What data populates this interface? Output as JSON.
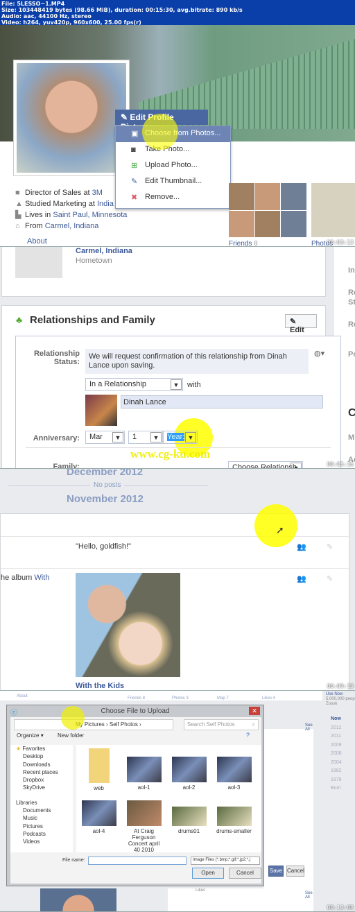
{
  "file_info": {
    "lines": [
      "File: 5LESSO~1.MP4",
      "Size: 103448419 bytes (98.66 MiB), duration: 00:15:30, avg.bitrate: 890 kb/s",
      "Audio: aac, 44100 Hz, stereo",
      "Video: h264, yuv420p, 960x600, 25.00 fps(r)"
    ]
  },
  "frame1": {
    "timestamp": "00:03:13",
    "menu_header": "Edit Profile Picture",
    "menu_items": [
      {
        "label": "Choose from Photos...",
        "icon": "photos-icon"
      },
      {
        "label": "Take Photo...",
        "icon": "camera-icon"
      },
      {
        "label": "Upload Photo...",
        "icon": "upload-photo-icon"
      },
      {
        "label": "Edit Thumbnail...",
        "icon": "pencil-icon"
      },
      {
        "label": "Remove...",
        "icon": "remove-icon"
      }
    ],
    "info": [
      {
        "pre": "Director of Sales at ",
        "link": "3M",
        "icon": "briefcase-icon"
      },
      {
        "pre": "Studied Marketing at ",
        "link": "India",
        "icon": "graduation-icon"
      },
      {
        "pre": "Lives in ",
        "link": "Saint Paul, Minnesota",
        "icon": "city-icon"
      },
      {
        "pre": "From ",
        "link": "Carmel, Indiana",
        "icon": "home-icon"
      }
    ],
    "about": "About",
    "friends": "Friends",
    "friends_count": "8",
    "photos": "Photos"
  },
  "frame2": {
    "timestamp": "00:05:16",
    "hometown": "Carmel, Indiana",
    "hometown_label": "Hometown",
    "section_title": "Relationships and Family",
    "edit": "Edit",
    "rel_label": "Relationship Status:",
    "notice": "We will request confirmation of this relationship from Dinah Lance upon saving.",
    "status": "In a Relationship",
    "with": "with",
    "partner": "Dinah Lance",
    "anniv_label": "Anniversary:",
    "month": "Mar",
    "day": "1",
    "year": "Year:",
    "family_label": "Family:",
    "choose_rel": "Choose Relationsh",
    "watermark": "www.cg-ku.com",
    "side": [
      "In",
      "Re",
      "St",
      "Re",
      "Po",
      "C",
      "M",
      "Ac"
    ]
  },
  "frame3": {
    "timestamp": "00:09:19",
    "month1": "December 2012",
    "no_posts": "No posts",
    "month2": "November 2012",
    "post1": "\"Hello, goldfish!\"",
    "album_pre": "he album ",
    "album_link": "With",
    "album_title": "With the Kids"
  },
  "frame4": {
    "timestamp": "00:13:08",
    "tabs": [
      "About",
      "Friends 8",
      "Photos 3",
      "Map 7",
      "Likes 4"
    ],
    "dialog_title": "Choose File to Upload",
    "path": [
      "My Pictures",
      "Self Photos"
    ],
    "search_placeholder": "Search Self Photos",
    "organize": "Organize",
    "new_folder": "New folder",
    "favorites": "Favorites",
    "fav_items": [
      "Desktop",
      "Downloads",
      "Recent places",
      "Dropbox",
      "SkyDrive"
    ],
    "libraries": "Libraries",
    "lib_items": [
      "Documents",
      "Music",
      "Pictures",
      "Podcasts",
      "Videos"
    ],
    "files": [
      "web",
      "aol-1",
      "aol-2",
      "aol-3",
      "aol-4",
      "At Craig Ferguson Concert april 40 2010",
      "drums01",
      "drums-smaller"
    ],
    "file_name_label": "File name:",
    "file_type": "Image Files (*.bmp;*.gif;*.jp2;*.j",
    "open": "Open",
    "cancel": "Cancel",
    "save": "Save",
    "cancel2": "Cancel",
    "see_all": "See All",
    "likes": "Likes",
    "ad": "Use Now",
    "ad_sub": "5,000,000 peop",
    "ad_brand": "Zoosk",
    "timeline": [
      "Now",
      "2012",
      "2011",
      "2009",
      "2008",
      "2004",
      "1982",
      "1978",
      "Born"
    ]
  }
}
